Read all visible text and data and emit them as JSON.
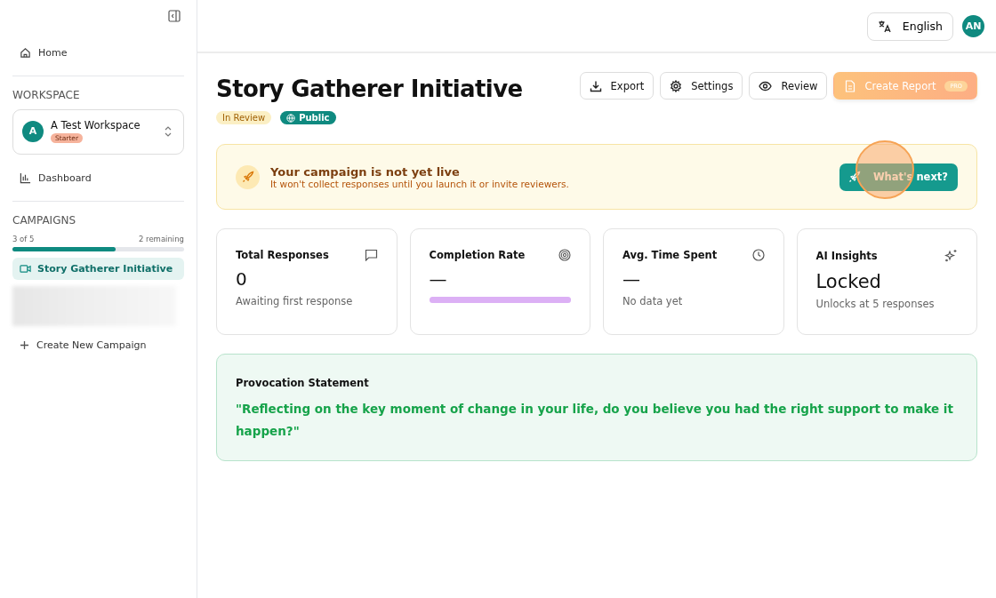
{
  "sidebar": {
    "home": {
      "label": "Home"
    },
    "workspace_heading": "WORKSPACE",
    "workspace": {
      "avatar": "A",
      "name": "A Test Workspace",
      "plan": "Starter"
    },
    "dashboard": {
      "label": "Dashboard"
    },
    "campaigns_heading": "CAMPAIGNS",
    "campaign_usage": {
      "used": "3 of 5",
      "remaining": "2 remaining",
      "level": 0.6
    },
    "campaigns": [
      {
        "kind": "campaign",
        "label": "Story Gatherer Initiative",
        "selected": true
      },
      {
        "kind": "redacted"
      }
    ],
    "create_campaign": "Create New Campaign"
  },
  "header": {
    "language": "English",
    "avatar": "AN"
  },
  "campaign": {
    "title": "Story Gatherer Initiative",
    "status": "In Review",
    "visibility": "Public"
  },
  "actions": [
    {
      "kind": "export",
      "label": "Export"
    },
    {
      "kind": "settings",
      "label": "Settings"
    },
    {
      "kind": "review",
      "label": "Review"
    },
    {
      "kind": "report",
      "label": "Create Report",
      "badge": "PRO",
      "disabled": true
    }
  ],
  "notice": {
    "title": "Your campaign is not yet live",
    "text": "It won't collect responses until you launch it or invite reviewers.",
    "button": "What's next?",
    "click_marker": true
  },
  "stats": [
    {
      "kind": "responses",
      "title": "Total Responses",
      "value": "0",
      "note": "Awaiting first response"
    },
    {
      "kind": "completion",
      "title": "Completion Rate",
      "value": "—",
      "level": 1
    },
    {
      "kind": "time",
      "title": "Avg. Time Spent",
      "value": "—",
      "note": "No data yet"
    },
    {
      "kind": "insights",
      "title": "AI Insights",
      "value": "Locked",
      "note": "Unlocks at 5 responses"
    }
  ],
  "provocation": {
    "label": "Provocation Statement",
    "text": "\"Reflecting on the key moment of change in your life, do you believe you had the right support to make it happen?\""
  }
}
